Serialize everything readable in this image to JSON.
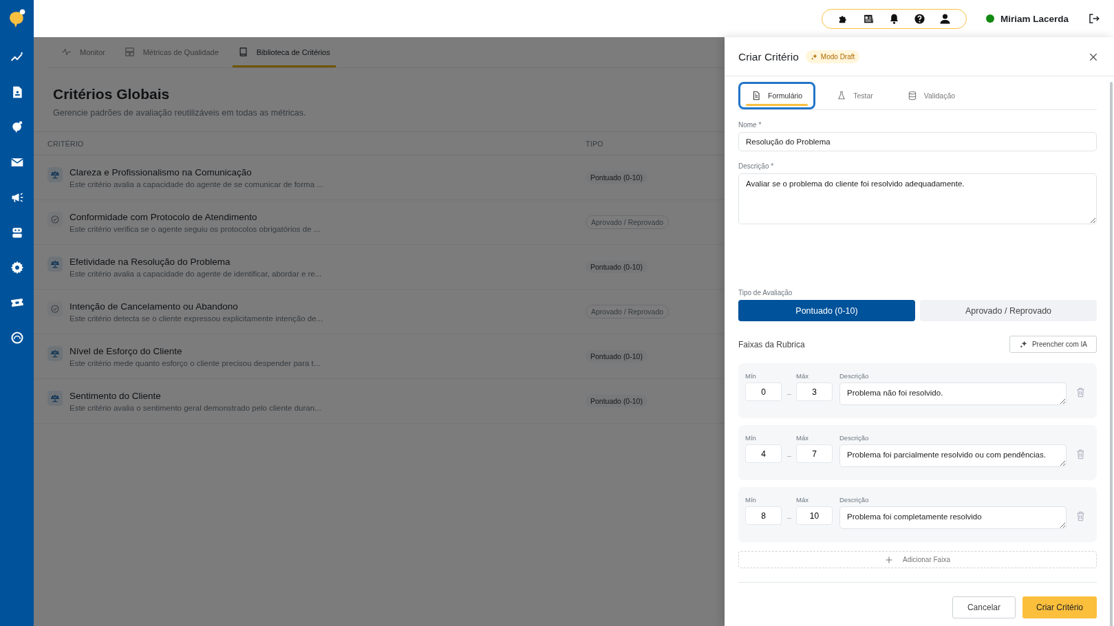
{
  "header": {
    "user": {
      "name": "Miriam Lacerda",
      "online": true
    }
  },
  "tabs": [
    {
      "label": "Monitor",
      "selected": false
    },
    {
      "label": "Métricas de Qualidade",
      "selected": false
    },
    {
      "label": "Biblioteca de Critérios",
      "selected": true
    }
  ],
  "page": {
    "title": "Critérios Globais",
    "subtitle": "Gerencie padrões de avaliação reutilizáveis em todas as métricas."
  },
  "table": {
    "columns": [
      "CRITÉRIO",
      "TIPO"
    ],
    "rows": [
      {
        "kind": "scored",
        "title": "Clareza e Profissionalismo na Comunicação",
        "description": "Este critério avalia a capacidade do agente de se comunicar de forma ...",
        "type": "Pontuado (0-10)"
      },
      {
        "kind": "pass_fail",
        "title": "Conformidade com Protocolo de Atendimento",
        "description": "Este critério verifica se o agente seguiu os protocolos obrigatórios de ...",
        "type": "Aprovado / Reprovado"
      },
      {
        "kind": "scored",
        "title": "Efetividade na Resolução do Problema",
        "description": "Este critério avalia a capacidade do agente de identificar, abordar e re...",
        "type": "Pontuado (0-10)"
      },
      {
        "kind": "pass_fail",
        "title": "Intenção de Cancelamento ou Abandono",
        "description": "Este critério detecta se o cliente expressou explicitamente intenção de...",
        "type": "Aprovado / Reprovado"
      },
      {
        "kind": "scored",
        "title": "Nível de Esforço do Cliente",
        "description": "Este critério mede quanto esforço o cliente precisou despender para t...",
        "type": "Pontuado (0-10)"
      },
      {
        "kind": "scored",
        "title": "Sentimento do Cliente",
        "description": "Este critério avalia o sentimento geral demonstrado pelo cliente duran...",
        "type": "Pontuado (0-10)"
      }
    ]
  },
  "drawer": {
    "title": "Criar Critério",
    "badge": "Modo Draft",
    "tabs": [
      {
        "label": "Formulário",
        "selected": true
      },
      {
        "label": "Testar",
        "selected": false
      },
      {
        "label": "Validação",
        "selected": false
      }
    ],
    "name_field": {
      "label": "Nome *",
      "value": "Resolução do Problema"
    },
    "description_field": {
      "label": "Descrição *",
      "value": "Avaliar se o problema do cliente foi resolvido adequadamente."
    },
    "evaluation_type": {
      "label": "Tipo de Avaliação",
      "options": [
        {
          "label": "Pontuado (0-10)",
          "selected": true
        },
        {
          "label": "Aprovado / Reprovado",
          "selected": false
        }
      ]
    },
    "rubric": {
      "title": "Faixas da Rubrica",
      "ai_button": "Preencher com IA",
      "bands": [
        {
          "min_label": "Mín",
          "min": "0",
          "max_label": "Máx",
          "max": "3",
          "desc_label": "Descrição",
          "desc": "Problema não foi resolvido."
        },
        {
          "min_label": "Mín",
          "min": "4",
          "max_label": "Máx",
          "max": "7",
          "desc_label": "Descrição",
          "desc": "Problema foi parcialmente resolvido ou com pendências."
        },
        {
          "min_label": "Mín",
          "min": "8",
          "max_label": "Máx",
          "max": "10",
          "desc_label": "Descrição",
          "desc": "Problema foi completamente resolvido"
        }
      ],
      "add_button": "Adicionar Faixa"
    },
    "buttons": {
      "cancel": "Cancelar",
      "submit": "Criar Critério"
    }
  }
}
